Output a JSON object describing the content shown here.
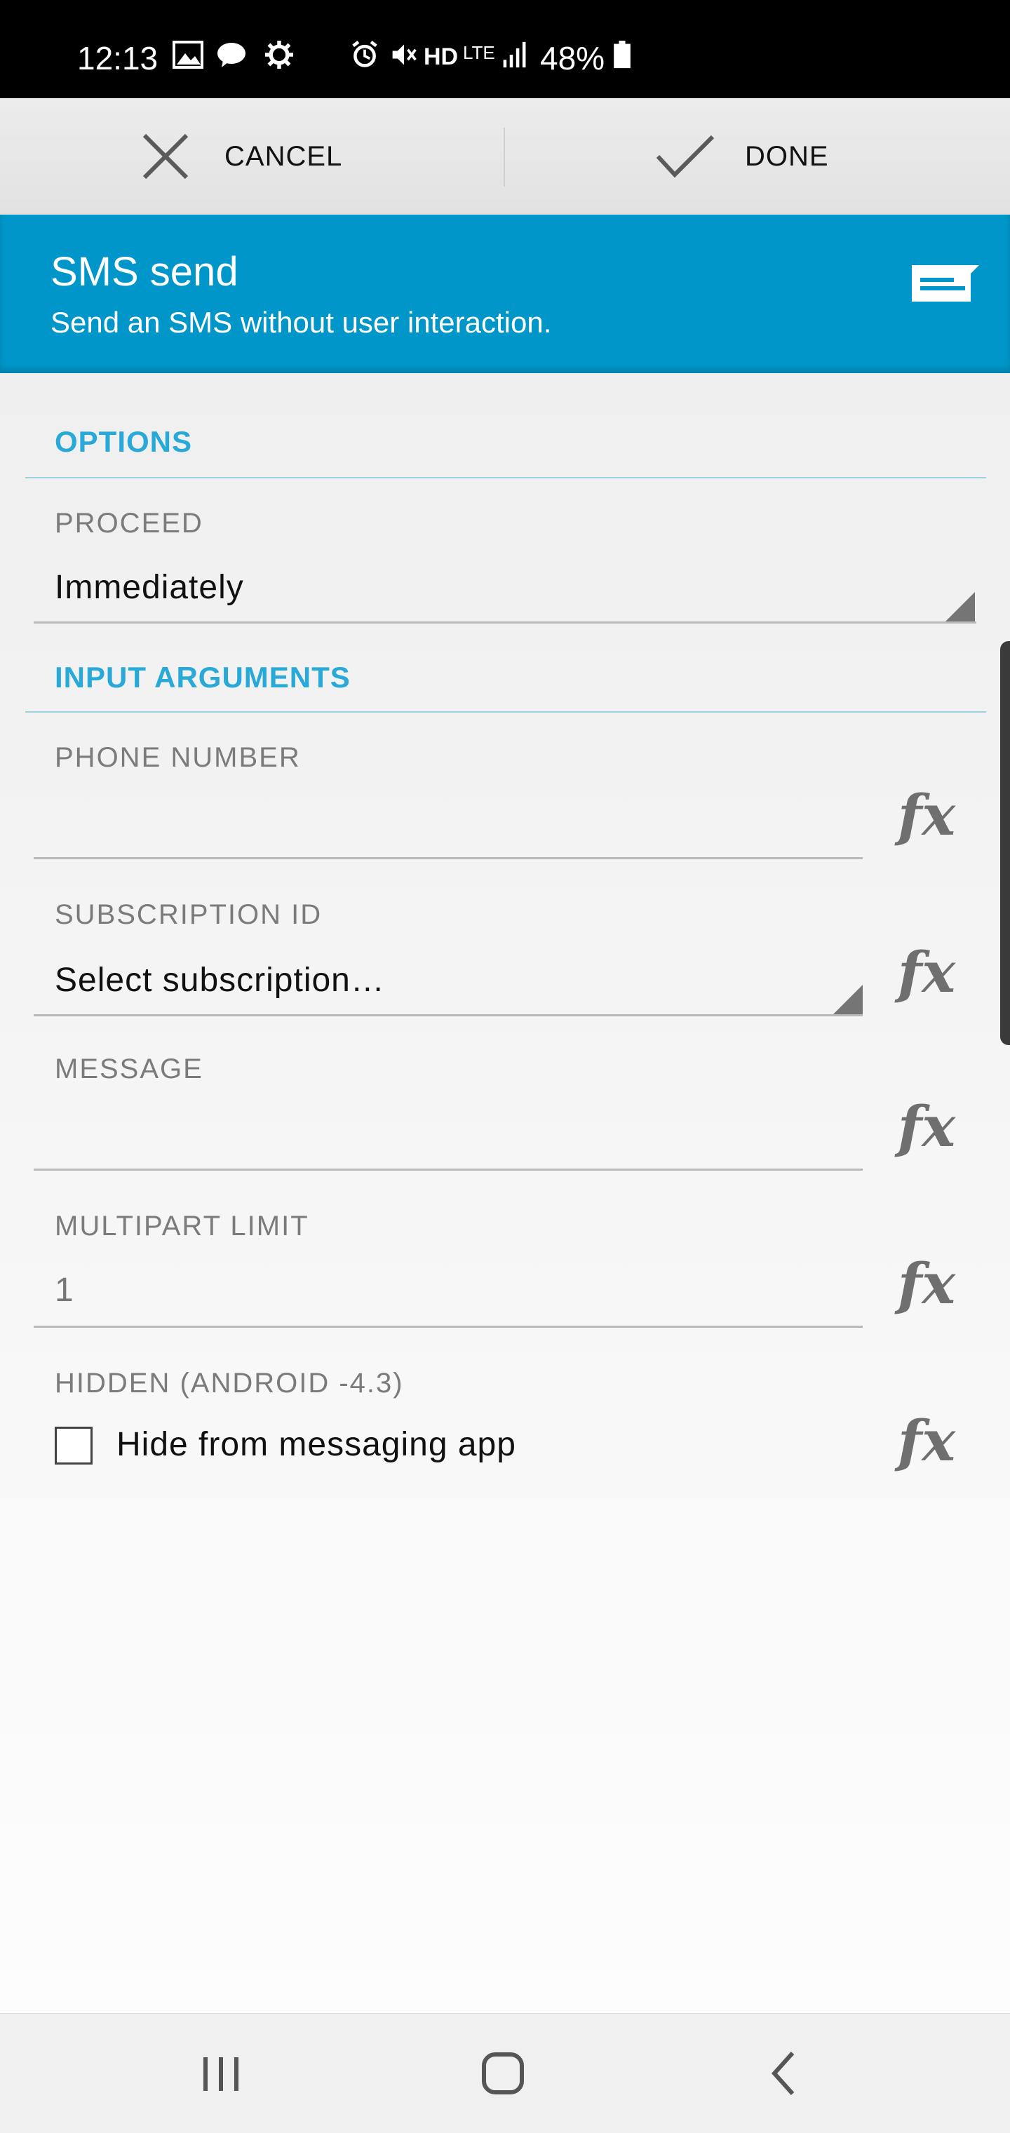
{
  "status_bar": {
    "time": "12:13",
    "battery": "48%",
    "network_hd": "HD",
    "network_lte": "LTE",
    "icons": [
      "image-icon",
      "talk-icon",
      "settings-icon",
      "alarm-icon",
      "mute-icon",
      "signal-icon",
      "battery-icon"
    ]
  },
  "action_bar": {
    "cancel_label": "CANCEL",
    "done_label": "DONE"
  },
  "header": {
    "title": "SMS send",
    "subtitle": "Send an SMS without user interaction.",
    "accent_color": "#0096c9"
  },
  "options": {
    "section_label": "OPTIONS",
    "proceed_label": "PROCEED",
    "proceed_value": "Immediately"
  },
  "input_arguments": {
    "section_label": "INPUT ARGUMENTS",
    "phone_number_label": "PHONE NUMBER",
    "phone_number_value": "",
    "subscription_id_label": "SUBSCRIPTION ID",
    "subscription_id_value": "Select subscription…",
    "message_label": "MESSAGE",
    "message_value": "",
    "multipart_limit_label": "MULTIPART LIMIT",
    "multipart_limit_value": "1",
    "hidden_label": "HIDDEN (ANDROID -4.3)",
    "hidden_checkbox_label": "Hide from messaging app",
    "hidden_checked": false,
    "fx_label": "fx"
  },
  "nav_bar": {
    "icons": [
      "recents-icon",
      "home-icon",
      "back-icon"
    ]
  }
}
